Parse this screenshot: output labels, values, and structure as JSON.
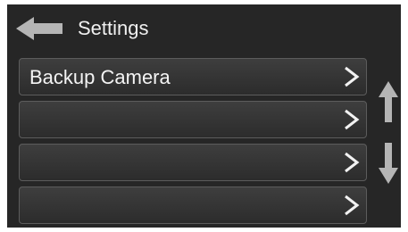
{
  "header": {
    "title": "Settings",
    "back_icon": "back-arrow-icon"
  },
  "menu": {
    "items": [
      {
        "label": "Backup Camera",
        "icon": "chevron-right-icon"
      },
      {
        "label": "",
        "icon": "chevron-right-icon"
      },
      {
        "label": "",
        "icon": "chevron-right-icon"
      },
      {
        "label": "",
        "icon": "chevron-right-icon"
      }
    ]
  },
  "scroll": {
    "up_icon": "arrow-up-icon",
    "down_icon": "arrow-down-icon"
  },
  "colors": {
    "background": "#262626",
    "row_border": "#5c5c5c",
    "icon": "#b5b5b5",
    "text": "#f2f2f2"
  }
}
